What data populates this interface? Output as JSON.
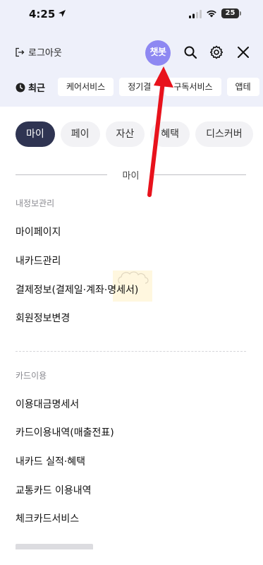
{
  "status_bar": {
    "time": "4:25",
    "battery": "25"
  },
  "header": {
    "logout_label": "로그아웃",
    "chatbot_label": "챗봇"
  },
  "recent": {
    "label": "최근",
    "chips": [
      "케어서비스",
      "정기결",
      "구독서비스",
      "앱테"
    ]
  },
  "tabs": [
    {
      "label": "마이",
      "active": true
    },
    {
      "label": "페이",
      "active": false
    },
    {
      "label": "자산",
      "active": false
    },
    {
      "label": "혜택",
      "active": false
    },
    {
      "label": "디스커버",
      "active": false
    }
  ],
  "section": {
    "title": "마이"
  },
  "groups": [
    {
      "label": "내정보관리",
      "items": [
        "마이페이지",
        "내카드관리",
        "결제정보(결제일·계좌·명세서)",
        "회원정보변경"
      ]
    },
    {
      "label": "카드이용",
      "items": [
        "이용대금명세서",
        "카드이용내역(매출전표)",
        "내카드 실적·혜택",
        "교통카드 이용내역",
        "체크카드서비스"
      ]
    }
  ],
  "colors": {
    "header_bg": "#eef0fa",
    "chatbot": "#8e88f2",
    "active_tab": "#2f3452",
    "annotation": "#e8121c"
  }
}
